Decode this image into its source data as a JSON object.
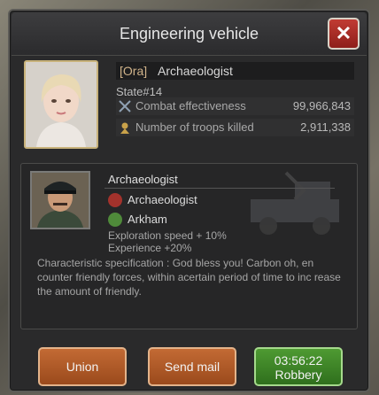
{
  "dialog": {
    "title": "Engineering vehicle",
    "close_label": "✕"
  },
  "player": {
    "alliance_tag": "[Ora]",
    "name": "Archaeologist",
    "state": "State#14",
    "stats": [
      {
        "icon": "crossed-swords-icon",
        "label": "Combat effectiveness",
        "value": "99,966,843"
      },
      {
        "icon": "kills-icon",
        "label": "Number of troops killed",
        "value": "2,911,338"
      }
    ]
  },
  "commander": {
    "name": "Archaeologist",
    "role": "Archaeologist",
    "faction": "Arkham",
    "buffs": [
      "Exploration speed + 10%",
      "Experience +20%"
    ],
    "description": "Characteristic specification : God bless you! Carbon oh, en counter friendly forces, within acertain period of time to inc rease the amount of friendly."
  },
  "actions": {
    "union": "Union",
    "send_mail": "Send mail",
    "robbery_timer": "03:56:22",
    "robbery": "Robbery"
  },
  "colors": {
    "accent_orange": "#b05a26",
    "accent_green": "#3f8a2a",
    "close_red": "#b0302a"
  }
}
